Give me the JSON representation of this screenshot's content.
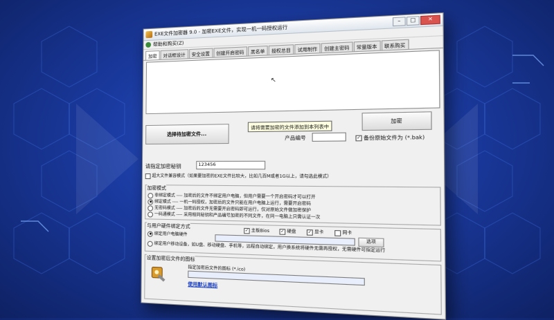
{
  "window": {
    "title": "EXE文件加密器 9.0 - 加密EXE文件，实现一机一码授权运行",
    "menu_help": "帮助和购买(Z)"
  },
  "tabs": [
    "加密",
    "对话框设计",
    "安全设置",
    "创建开启密码",
    "黑名单",
    "授权总目",
    "试用制作",
    "创建主密码",
    "常量版本",
    "联系购买"
  ],
  "main": {
    "select_file_button": "选择待加密文件...",
    "tooltip": "请将需要加密的文件添加到本列表中",
    "product_id_label": "产品编号",
    "backup_checkbox": "备份原始文件为 (*.bak)",
    "encrypt_button": "加密",
    "password_label": "请指定加密秘钥",
    "password_value": "123456",
    "password_hint": "（如果要加密的EXE文件比较大，比如几百M或者1G以上，请勾选此模式）",
    "large_file_mode": "超大文件兼容模式（如果要加密的EXE文件比较大，比如几百M或者1G以上，请勾选此模式）",
    "mode_group_label": "加密模式",
    "modes": [
      {
        "label": "非绑定模式 ---- 加密后的文件不绑定用户电脑，但用户需要一个开启密码才可以打开",
        "selected": false
      },
      {
        "label": "绑定模式 ---- 一机一码授权，加密后的文件只能在用户电脑上运行，需要开启密码",
        "selected": true
      },
      {
        "label": "无密码模式 ---- 加密后的文件无需要开启密码即可运行，仅对原始文件做加密保护",
        "selected": false
      },
      {
        "label": "一码通模式 ---- 采用相同秘钥和产品编号加密的不同文件，在同一电脑上只需认证一次",
        "selected": false
      }
    ],
    "bind_group_label": "与用户硬件绑定方式",
    "bind_options": [
      {
        "label": "绑定用户电脑硬件",
        "selected": true
      },
      {
        "label": "绑定用户移动设备，如U盘、移动硬盘、手机等，远程自动绑定，用户换系统将硬件无需再授权，无需硬件可指定运行",
        "selected": false
      }
    ],
    "hw_checks": [
      {
        "label": "主板Bios",
        "checked": true
      },
      {
        "label": "硬盘",
        "checked": true
      },
      {
        "label": "显卡",
        "checked": true
      },
      {
        "label": "网卡",
        "checked": false
      }
    ],
    "browse_button": "选项",
    "icon_group_label": "设置加密后文件的图标",
    "icon_select_label": "指定加密后文件的图标 (*.ico)",
    "default_icon_link": "使用默认图标"
  }
}
